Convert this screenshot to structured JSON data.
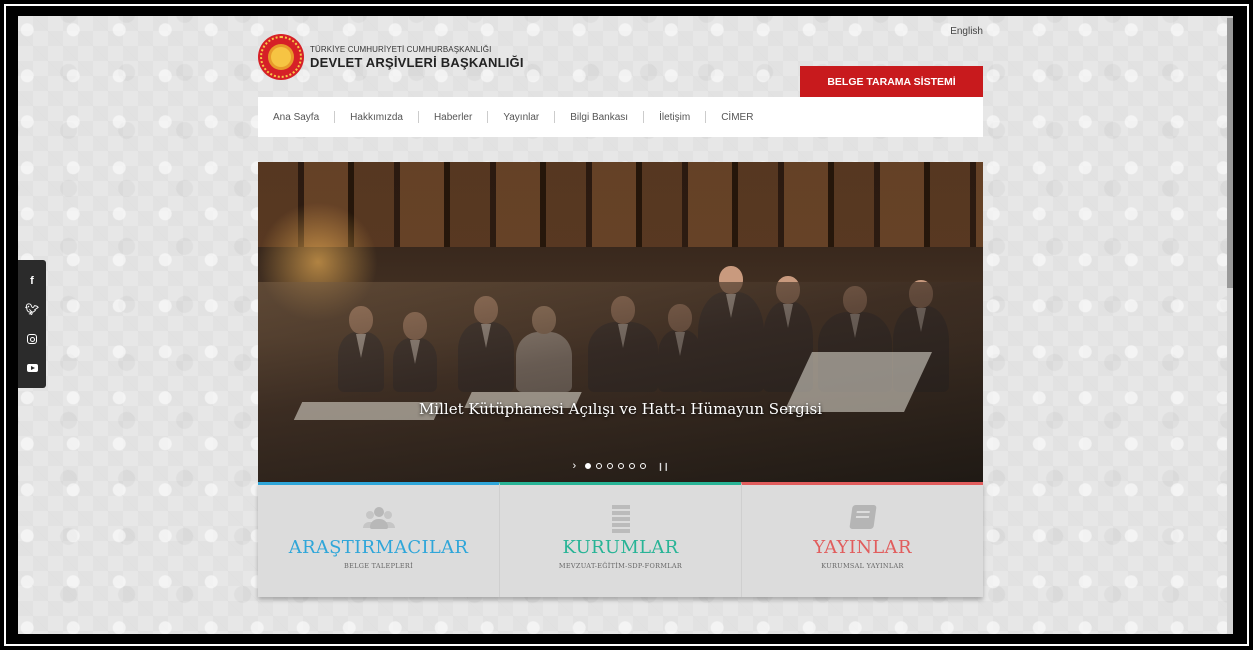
{
  "header": {
    "language_link": "English",
    "logo": {
      "line1": "TÜRKİYE CUMHURİYETİ CUMHURBAŞKANLIĞI",
      "line2": "DEVLET ARŞİVLERİ BAŞKANLIĞI"
    },
    "belge_button": "BELGE TARAMA SİSTEMİ"
  },
  "nav": {
    "items": [
      {
        "label": "Ana Sayfa"
      },
      {
        "label": "Hakkımızda"
      },
      {
        "label": "Haberler"
      },
      {
        "label": "Yayınlar"
      },
      {
        "label": "Bilgi Bankası"
      },
      {
        "label": "İletişim"
      },
      {
        "label": "CİMER"
      }
    ]
  },
  "social": {
    "icons": [
      "facebook-icon",
      "twitter-icon",
      "instagram-icon",
      "youtube-icon"
    ]
  },
  "slider": {
    "caption": "Millet Kütüphanesi Açılışı ve Hatt-ı Hümayun Sergisi",
    "dot_count": 6,
    "active_dot": 0
  },
  "cards": [
    {
      "title": "ARAŞTIRMACILAR",
      "subtitle": "BELGE TALEPLERİ",
      "color": "#2fa6d9",
      "icon": "users-icon"
    },
    {
      "title": "KURUMLAR",
      "subtitle": "MEVZUAT-EĞİTİM-SDP-FORMLAR",
      "color": "#28b496",
      "icon": "building-icon"
    },
    {
      "title": "YAYINLAR",
      "subtitle": "KURUMSAL YAYINLAR",
      "color": "#e15d5d",
      "icon": "book-icon"
    }
  ],
  "colors": {
    "brand_red": "#c81a1d",
    "accent_blue": "#2fa6d9",
    "accent_green": "#28b496",
    "accent_red": "#e15d5d"
  }
}
